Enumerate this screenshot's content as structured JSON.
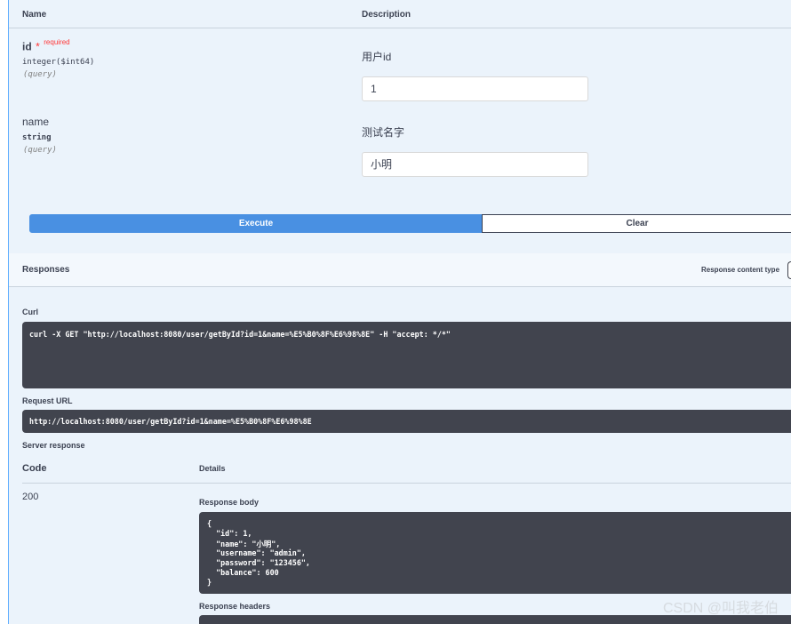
{
  "parameters": {
    "header_name": "Name",
    "header_description": "Description",
    "items": [
      {
        "name": "id",
        "required_mark": "*",
        "required_label": "required",
        "type": "integer($int64)",
        "location": "(query)",
        "description": "用户id",
        "value": "1"
      },
      {
        "name": "name",
        "type": "string",
        "location": "(query)",
        "description": "测试名字",
        "value": "小明"
      }
    ]
  },
  "actions": {
    "execute_label": "Execute",
    "clear_label": "Clear"
  },
  "responses": {
    "title": "Responses",
    "content_type_label": "Response content type",
    "curl_label": "Curl",
    "curl_command": "curl -X GET \"http://localhost:8080/user/getById?id=1&name=%E5%B0%8F%E6%98%8E\" -H \"accept: */*\"",
    "request_url_label": "Request URL",
    "request_url": "http://localhost:8080/user/getById?id=1&name=%E5%B0%8F%E6%98%8E",
    "server_response_label": "Server response",
    "code_header": "Code",
    "details_header": "Details",
    "status_code": "200",
    "response_body_label": "Response body",
    "response_body_lines": [
      "{",
      "  \"id\": 1,",
      "  \"name\": \"小明\",",
      "  \"username\": \"admin\",",
      "  \"password\": \"123456\",",
      "  \"balance\": 600",
      "}"
    ],
    "response_headers_label": "Response headers"
  },
  "watermark": "CSDN @叫我老伯",
  "colors": {
    "execute": "#4990e2",
    "code_bg": "#41444e",
    "panel_bg": "#ebf3fb",
    "required": "#ff3636"
  }
}
